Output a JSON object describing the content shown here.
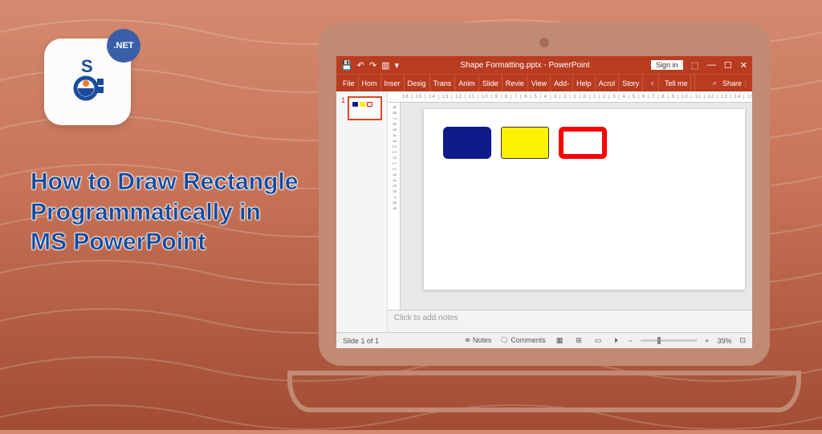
{
  "article": {
    "title": "How to Draw Rectangle\nProgrammatically in\nMS PowerPoint",
    "badge_text": ".NET"
  },
  "pp": {
    "titlebar": {
      "doc_title": "Shape Formatting.pptx - PowerPoint",
      "signin": "Sign in"
    },
    "ribbon": {
      "tabs": [
        "File",
        "Hom",
        "Inser",
        "Desig",
        "Trans",
        "Anim",
        "Slide",
        "Revie",
        "View",
        "Add-",
        "Help",
        "Acrol",
        "Story"
      ],
      "tellme": "Tell me",
      "share": "Share"
    },
    "ruler_h": "16 | 15 | 14 | 13 | 12 | 11 | 10 | 9 | 8 | 7 | 6 | 5 | 4 | 3 | 2 | 1 | 0 | 1 | 2 | 3 | 4 | 5 | 6 | 7 | 8 | 9 | 10 | 11 | 12 | 13 | 14 | 15 | 16",
    "ruler_v": "9 8 7 6 5 4 3 2 1 0 1 2 3 4 5 6 7 8 9",
    "thumb_number": "1",
    "notes_placeholder": "Click to add notes",
    "status": {
      "slide_info": "Slide 1 of 1",
      "notes_btn": "Notes",
      "comments_btn": "Comments",
      "zoom_level": "39%"
    },
    "shapes": {
      "blue": "#0e1a8a",
      "yellow": "#fff200",
      "red_outline": "#ff0000"
    }
  }
}
